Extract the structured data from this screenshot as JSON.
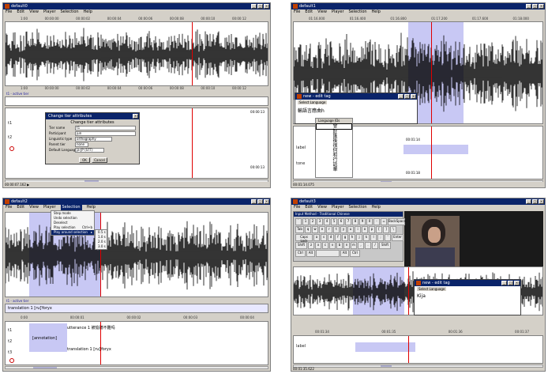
{
  "panel1": {
    "title": "default0",
    "menu": [
      "File",
      "Edit",
      "View",
      "Player",
      "Selection",
      "Help"
    ],
    "ruler_top": [
      "1:00",
      "00:00:00",
      "00:00:02",
      "00:00:04",
      "00:00:06",
      "00:00:08",
      "00:00:10",
      "00:00:12"
    ],
    "ruler_bottom": [
      "1:00",
      "00:00:00",
      "00:00:02",
      "00:00:04",
      "00:00:06",
      "00:00:08",
      "00:00:10",
      "00:00:12"
    ],
    "selected_tier_label": "t1 - active tier",
    "tier_labels": [
      "t1",
      "t2"
    ],
    "timecode": "00:00:13",
    "status": "00:00:07.162 ▶",
    "dialog": {
      "title": "Change tier attributes",
      "heading": "Change tier attributes",
      "rows": [
        {
          "label": "Tier name",
          "value": "t1"
        },
        {
          "label": "Participant",
          "value": "jun"
        },
        {
          "label": "Linguistic type",
          "value": "orthography"
        },
        {
          "label": "Parent tier",
          "value": "none"
        },
        {
          "label": "Default Language",
          "value": "ja-JP (STT)"
        }
      ],
      "ok": "OK",
      "cancel": "Cancel"
    }
  },
  "panel2": {
    "title": "default1",
    "menu": [
      "File",
      "Edit",
      "View",
      "Player",
      "Selection",
      "Help"
    ],
    "ruler": [
      "01:16.000",
      "01:16.400",
      "01:16.800",
      "01:17.200",
      "01:17.600",
      "01:18.000"
    ],
    "tier_labels": [
      "label",
      "tone"
    ],
    "timecode_a": "00:01:14",
    "timecode_b": "00:01:18",
    "status": "00:01:14.075",
    "edit_dialog": {
      "title": "new - edit tag",
      "section": "Select Language",
      "text": "輸語言應曲h"
    },
    "candidates": {
      "header": "Language IDs",
      "items": [
        "會",
        "好",
        "匯",
        "後",
        "很",
        "何",
        "和",
        "行",
        "話",
        "華"
      ]
    }
  },
  "panel3": {
    "title": "default2",
    "menu": [
      "File",
      "Edit",
      "View",
      "Player",
      "Selection",
      "Help"
    ],
    "selection_menu": [
      {
        "label": "Step mode",
        "shortcut": ""
      },
      {
        "label": "Undo selection",
        "shortcut": ""
      },
      {
        "label": "Deselect",
        "shortcut": ""
      },
      {
        "label": "Play selection",
        "shortcut": "Ctrl+b"
      },
      {
        "label": "Play around selection",
        "shortcut": "▸"
      }
    ],
    "submenu": [
      "0.5 s",
      "1.0 s",
      "2.0 s",
      "3.0 s"
    ],
    "selected_tier_label": "t1 - active tier",
    "translation_text": "translation 1 [ru]Yoryx",
    "ruler": [
      "0:00",
      "00:00:01",
      "00:00:02",
      "00:00:03",
      "00:00:04"
    ],
    "tier_labels": [
      "t1",
      "t2",
      "t3"
    ],
    "annotations": [
      "utterance 1 被偷聽不難吗",
      "[annotation]",
      "translation 1 [ru]Yoryx"
    ]
  },
  "panel4": {
    "title": "default3",
    "menu": [
      "File",
      "Edit",
      "View",
      "Player",
      "Selection",
      "Help"
    ],
    "keyboard_title": "Input Method - Traditional Chinese",
    "keyboard_rows": [
      [
        "`",
        "1",
        "2",
        "3",
        "4",
        "5",
        "6",
        "7",
        "8",
        "9",
        "0",
        "-",
        "=",
        "BackSpace"
      ],
      [
        "Tab",
        "q",
        "w",
        "e",
        "r",
        "t",
        "y",
        "u",
        "i",
        "o",
        "p",
        "[",
        "]",
        "\\"
      ],
      [
        "Caps Lock",
        "a",
        "s",
        "d",
        "f",
        "g",
        "h",
        "j",
        "k",
        "l",
        ";",
        "'",
        "Enter"
      ],
      [
        "Shift",
        "z",
        "x",
        "c",
        "v",
        "b",
        "n",
        "m",
        ",",
        ".",
        "/",
        "Shift"
      ],
      [
        "Ctrl",
        "Alt",
        "",
        "Alt",
        "Ctrl"
      ]
    ],
    "edit_dialog": {
      "title": "new - edit tag",
      "section": "Select Language",
      "text": "Kija"
    },
    "ruler": [
      "00:01:34",
      "00:01:35",
      "00:01:36",
      "00:01:37"
    ],
    "tier_labels": [
      "label"
    ],
    "status": "00:01:35.622"
  }
}
